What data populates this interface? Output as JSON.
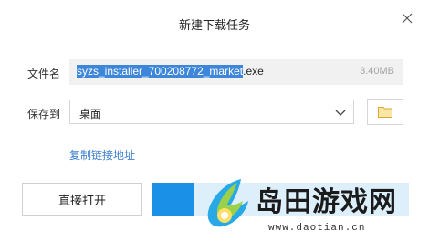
{
  "dialog": {
    "title": "新建下载任务"
  },
  "filename": {
    "label": "文件名",
    "selected_part": "syzs_installer_700208772_market",
    "extension": ".exe",
    "size": "3.40MB"
  },
  "save_to": {
    "label": "保存到",
    "value": "桌面"
  },
  "copy_link_label": "复制链接地址",
  "buttons": {
    "open_directly": "直接打开"
  },
  "watermark": {
    "brand": "岛田游戏网",
    "url": "www.daotian.cn"
  },
  "colors": {
    "accent": "#1a90e6",
    "link": "#3b7fd1",
    "selection": "#3d86d9"
  }
}
